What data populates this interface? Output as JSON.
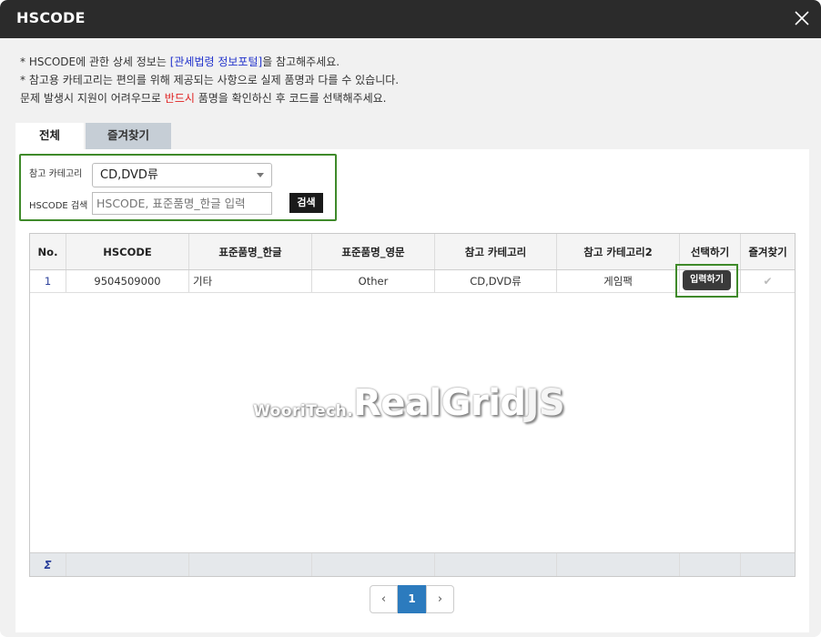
{
  "dialog": {
    "title": "HSCODE",
    "close_icon": "close-icon"
  },
  "notes": {
    "line1_pre": "* HSCODE에 관한 상세 정보는 ",
    "line1_link": "[관세법령 정보포털]",
    "line1_post": "을 참고해주세요.",
    "line2": "* 참고용 카테고리는 편의를 위해 제공되는 사항으로 실제 품명과 다를 수 있습니다.",
    "line3_pre": "문제 발생시 지원이 어려우므로 ",
    "line3_red": "반드시",
    "line3_post": " 품명을 확인하신 후 코드를 선택해주세요."
  },
  "tabs": [
    {
      "label": "전체",
      "active": true
    },
    {
      "label": "즐겨찾기",
      "active": false
    }
  ],
  "search": {
    "category_label": "참고 카테고리",
    "category_value": "CD,DVD류",
    "hscode_label": "HSCODE 검색",
    "placeholder": "HSCODE, 표준품명_한글 입력",
    "button_label": "검색"
  },
  "grid": {
    "columns": [
      "No.",
      "HSCODE",
      "표준품명_한글",
      "표준품명_영문",
      "참고 카테고리",
      "참고 카테고리2",
      "선택하기",
      "즐겨찾기"
    ],
    "rows": [
      {
        "no": "1",
        "hscode": "9504509000",
        "name_kr": "기타",
        "name_en": "Other",
        "category": "CD,DVD류",
        "category2": "게임팩",
        "select_label": "입력하기",
        "favorite_icon": "✔"
      }
    ],
    "footer_sigma": "Σ"
  },
  "watermark": {
    "brand": "WooriTech.",
    "product_main": "RealGrid",
    "product_suffix": "JS"
  },
  "pager": {
    "prev": "‹",
    "current": "1",
    "next": "›"
  },
  "colors": {
    "titlebar": "#2b2b2b",
    "highlight_border": "#3f8a2a",
    "link": "#2233cc",
    "warning": "#e02020",
    "pager_active": "#2c7bbe"
  }
}
